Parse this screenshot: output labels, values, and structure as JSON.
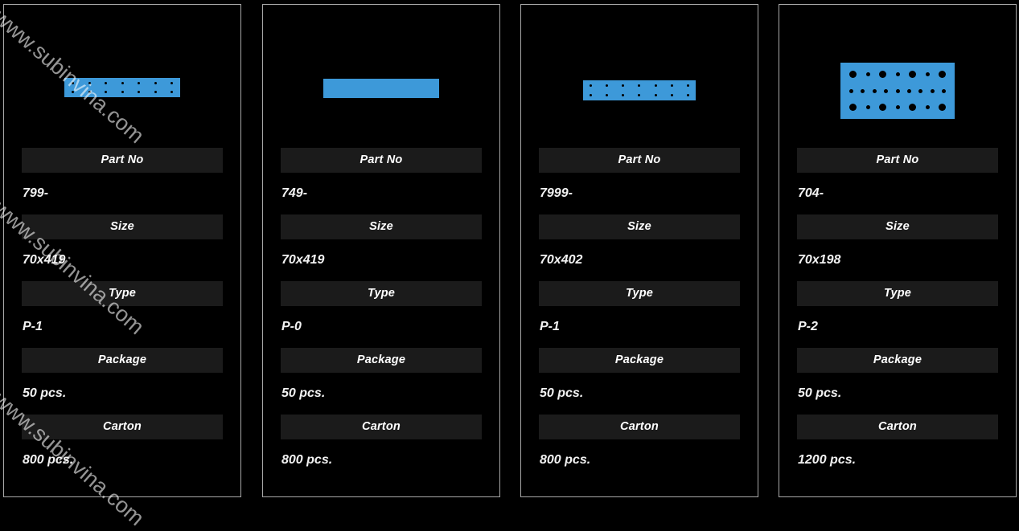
{
  "page": {
    "background_color": "#000000",
    "card_border_color": "#a8a8a8",
    "header_band_color": "#1b1b1b",
    "part_color": "#3d99d9",
    "hole_color": "#000000"
  },
  "watermark": {
    "text": "www.subinvina.com",
    "repeats": 3
  },
  "labels": {
    "part_no": "Part No",
    "size": "Size",
    "type": "Type",
    "package": "Package",
    "carton": "Carton"
  },
  "products": [
    {
      "figure": "perforated-bar-2row",
      "part_no": "799-",
      "size": "70x419",
      "type": "P-1",
      "package": "50 pcs.",
      "carton": "800 pcs."
    },
    {
      "figure": "plain-bar",
      "part_no": "749-",
      "size": "70x419",
      "type": "P-0",
      "package": "50 pcs.",
      "carton": "800 pcs."
    },
    {
      "figure": "perforated-bar-2row",
      "part_no": "7999-",
      "size": "70x402",
      "type": "P-1",
      "package": "50 pcs.",
      "carton": "800 pcs."
    },
    {
      "figure": "perforated-plate-3row",
      "part_no": "704-",
      "size": "70x198",
      "type": "P-2",
      "package": "50 pcs.",
      "carton": "1200 pcs."
    }
  ]
}
